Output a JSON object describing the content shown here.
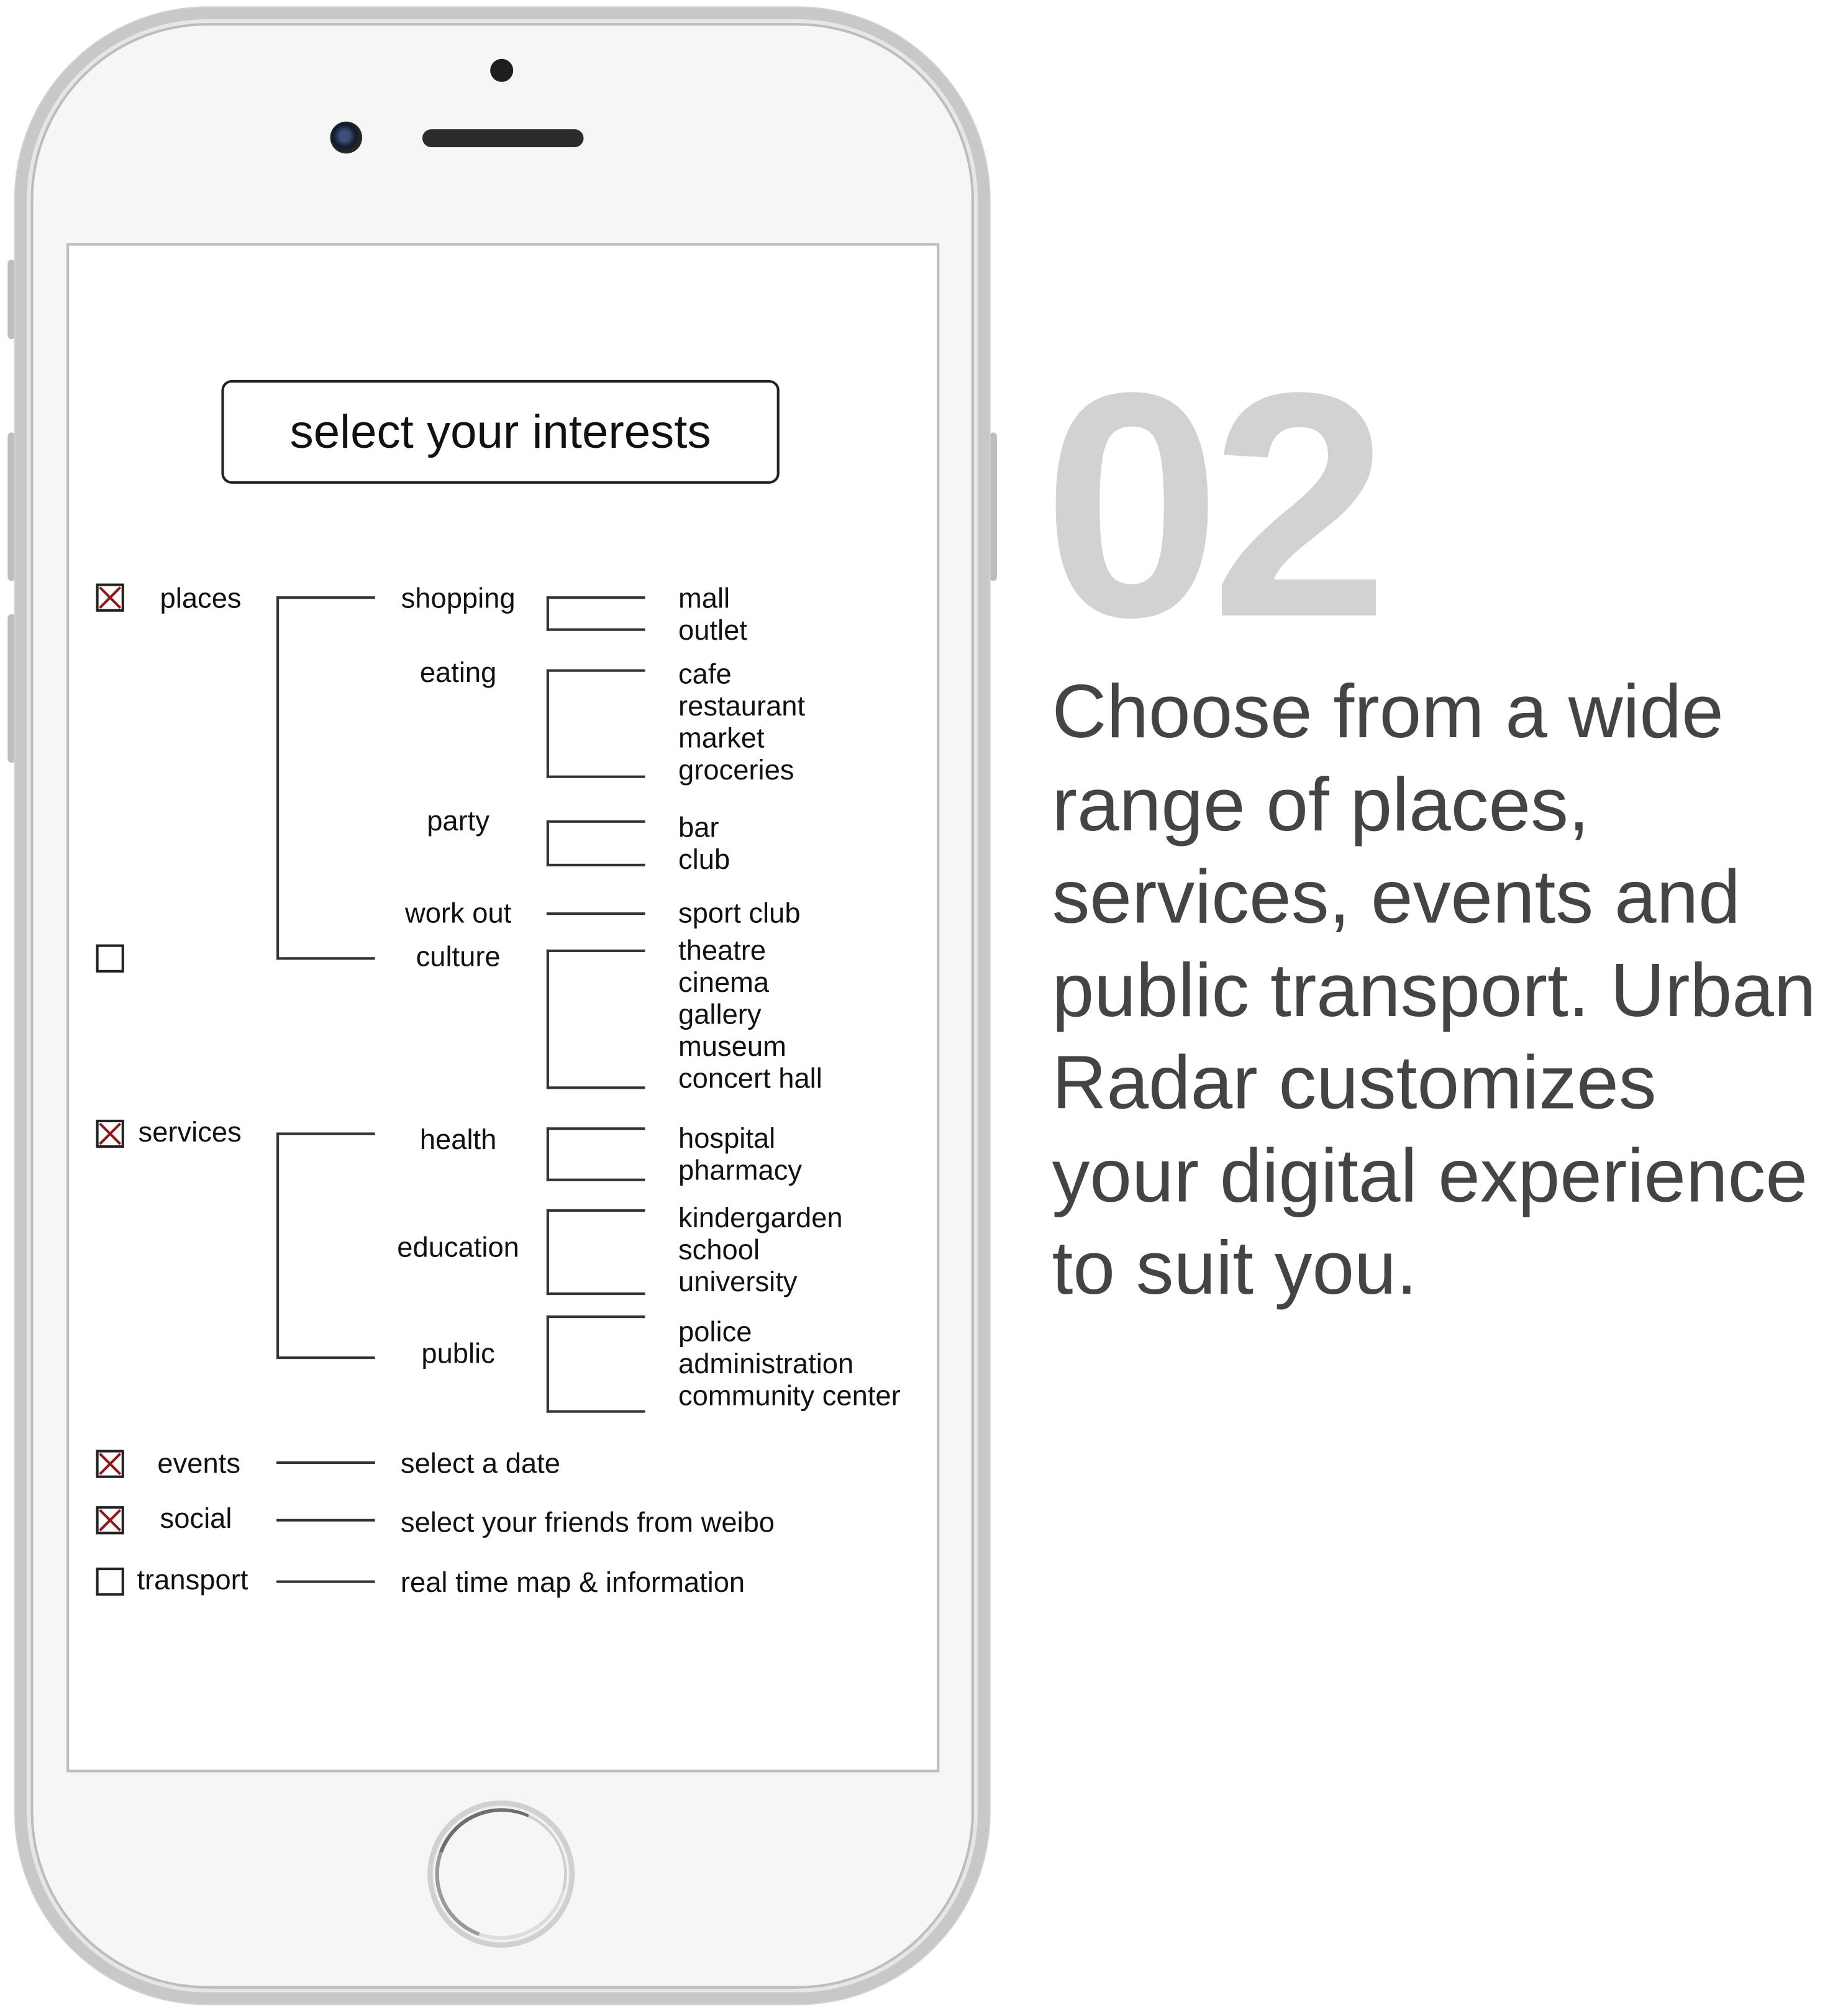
{
  "screen": {
    "title": "select your interests",
    "categories": {
      "places": {
        "label": "places",
        "checked": true
      },
      "culture": {
        "label": "",
        "checked": false
      },
      "services": {
        "label": "services",
        "checked": true
      },
      "events": {
        "label": "events",
        "checked": true
      },
      "social": {
        "label": "social",
        "checked": true
      },
      "transport": {
        "label": "transport",
        "checked": false
      }
    },
    "subcategories": {
      "shopping": "shopping",
      "eating": "eating",
      "party": "party",
      "work_out": "work out",
      "culture": "culture",
      "health": "health",
      "education": "education",
      "public": "public"
    },
    "items": {
      "shopping": [
        "mall",
        "outlet"
      ],
      "eating": [
        "cafe",
        "restaurant",
        "market",
        "groceries"
      ],
      "party": [
        "bar",
        "club"
      ],
      "work_out": [
        "sport club"
      ],
      "culture": [
        "theatre",
        "cinema",
        "gallery",
        "museum",
        "concert hall"
      ],
      "health": [
        "hospital",
        "pharmacy"
      ],
      "education": [
        "kindergarden",
        "school",
        "university"
      ],
      "public": [
        "police",
        "administration",
        "community center"
      ]
    },
    "actions": {
      "events": "select a date",
      "social": "select your friends from weibo",
      "transport": "real time map & information"
    }
  },
  "promo": {
    "step_number": "02",
    "description": "Choose from a wide range of places, services, events and public transport. Urban Radar customizes your digital experience to suit you."
  },
  "colors": {
    "check_mark": "#8b1a1a",
    "step_number": "#d1d2d4",
    "description": "#444444"
  }
}
